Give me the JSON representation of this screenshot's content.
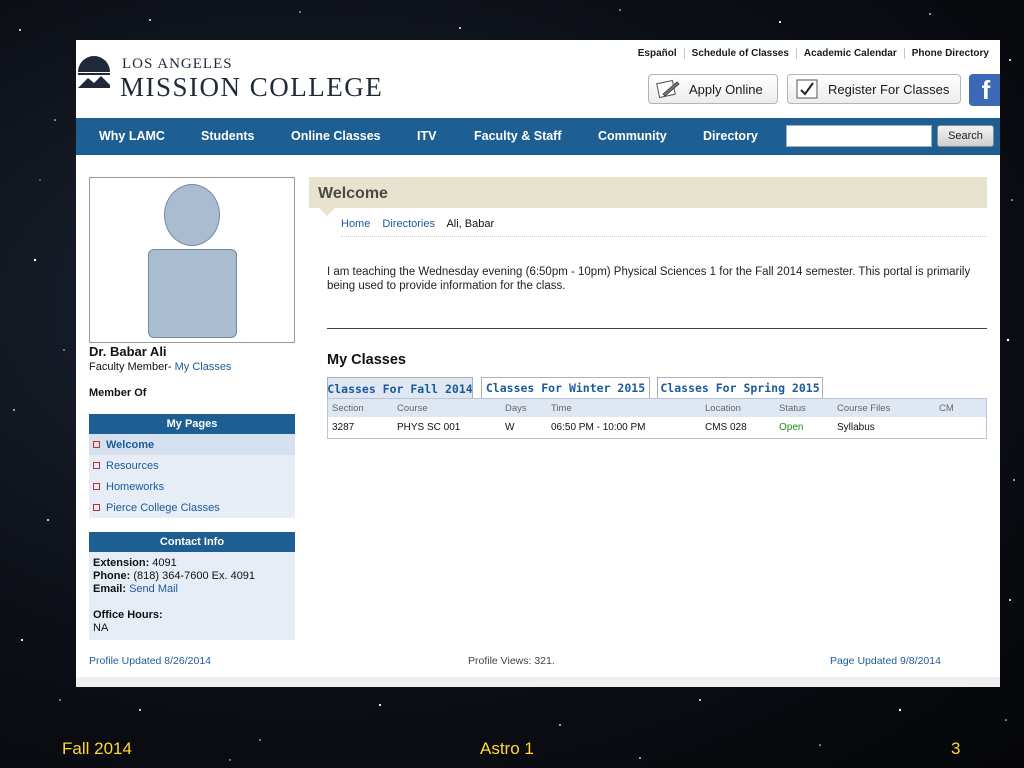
{
  "header": {
    "logo_top": "LOS ANGELES",
    "logo_bottom": "MISSION COLLEGE",
    "top_links": [
      "Español",
      "Schedule of Classes",
      "Academic Calendar",
      "Phone Directory"
    ],
    "apply_label": "Apply Online",
    "register_label": "Register For Classes",
    "facebook_glyph": "f"
  },
  "nav": {
    "items": [
      "Why LAMC",
      "Students",
      "Online Classes",
      "ITV",
      "Faculty & Staff",
      "Community",
      "Directory"
    ],
    "search_value": "",
    "search_button": "Search"
  },
  "profile": {
    "name": "Dr. Babar Ali",
    "role_prefix": "Faculty Member-",
    "role_link": "My Classes",
    "member_of": "Member Of"
  },
  "my_pages": {
    "title": "My Pages",
    "items": [
      "Welcome",
      "Resources",
      "Homeworks",
      "Pierce College Classes"
    ]
  },
  "contact": {
    "title": "Contact Info",
    "extension_label": "Extension:",
    "extension": "4091",
    "phone_label": "Phone:",
    "phone": "(818) 364-7600 Ex. 4091",
    "email_label": "Email:",
    "email": "Send Mail",
    "office_hours_label": "Office Hours:",
    "office_hours": "NA"
  },
  "main": {
    "title": "Welcome",
    "breadcrumbs": [
      "Home",
      "Directories",
      "Ali, Babar"
    ],
    "intro": "I am teaching the Wednesday evening (6:50pm - 10pm)  Physical Sciences 1 for the Fall 2014 semester.  This portal is primarily being used to provide information for the class.",
    "my_classes_title": "My Classes",
    "tabs": [
      "Classes For Fall 2014",
      "Classes For Winter 2015",
      "Classes For Spring 2015"
    ],
    "table": {
      "headers": [
        "Section",
        "Course",
        "Days",
        "Time",
        "Location",
        "Status",
        "Course Files",
        "CM"
      ],
      "rows": [
        [
          "3287",
          "PHYS SC 001",
          "W",
          "06:50 PM - 10:00 PM",
          "CMS 028",
          "Open",
          "Syllabus",
          ""
        ]
      ]
    }
  },
  "footer": {
    "profile_updated": "Profile Updated 8/26/2014",
    "profile_views": "Profile Views: 321.",
    "page_updated": "Page Updated 9/8/2014"
  },
  "slide": {
    "left": "Fall 2014",
    "center": "Astro 1",
    "right": "3"
  },
  "colors": {
    "nav_blue": "#1d5f93",
    "link_blue": "#1d5a9a",
    "open_green": "#1e8a1e",
    "slide_text": "#ffd838"
  }
}
